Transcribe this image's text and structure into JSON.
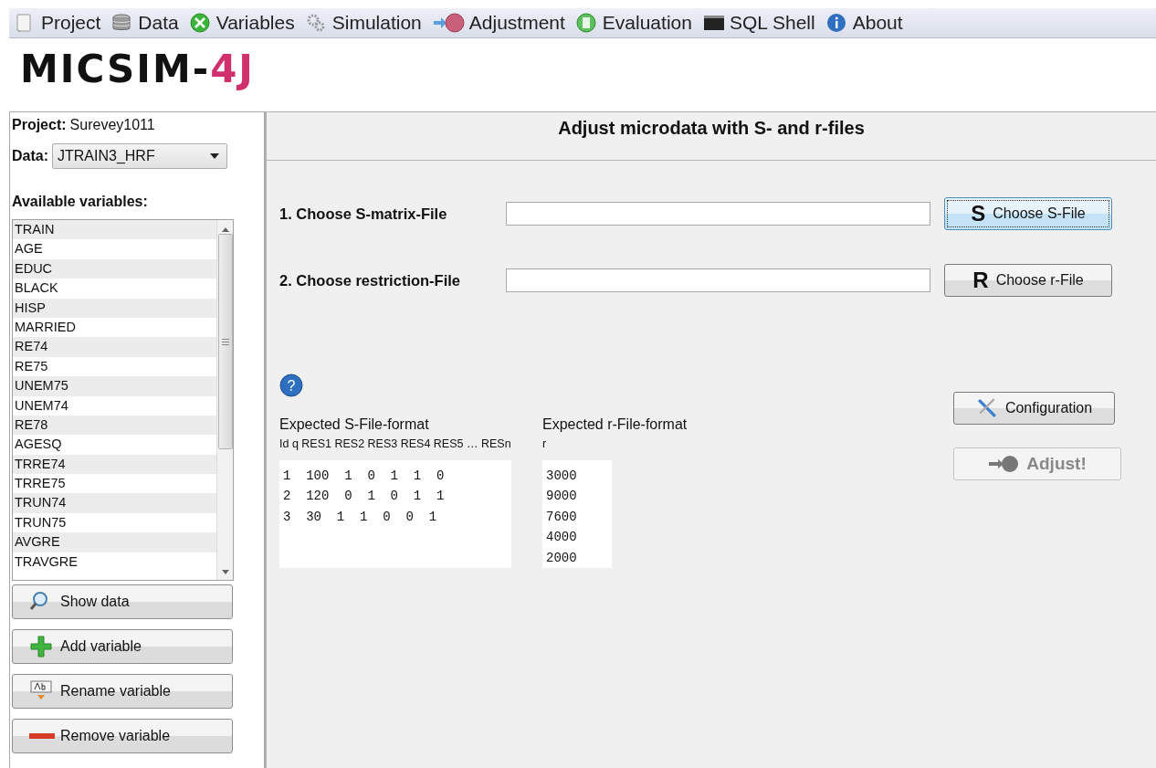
{
  "menu": [
    {
      "label": "Project"
    },
    {
      "label": "Data"
    },
    {
      "label": "Variables"
    },
    {
      "label": "Simulation"
    },
    {
      "label": "Adjustment"
    },
    {
      "label": "Evaluation"
    },
    {
      "label": "SQL Shell"
    },
    {
      "label": "About"
    }
  ],
  "logo": {
    "main": "MICSIM-",
    "accent": "4J"
  },
  "sidebar": {
    "project_label": "Project:",
    "project_name": "Surevey1011",
    "data_label": "Data:",
    "data_value": "JTRAIN3_HRF",
    "variables_heading": "Available variables:",
    "variables": [
      "TRAIN",
      "AGE",
      "EDUC",
      "BLACK",
      "HISP",
      "MARRIED",
      "RE74",
      "RE75",
      "UNEM75",
      "UNEM74",
      "RE78",
      "AGESQ",
      "TRRE74",
      "TRRE75",
      "TRUN74",
      "TRUN75",
      "AVGRE",
      "TRAVGRE"
    ],
    "buttons": [
      {
        "label": "Show data"
      },
      {
        "label": "Add variable"
      },
      {
        "label": "Rename variable"
      },
      {
        "label": "Remove variable"
      }
    ]
  },
  "main": {
    "title": "Adjust microdata with S- and r-files",
    "help_glyph": "?",
    "file_rows": [
      {
        "label": "1. Choose S-matrix-File",
        "value": "",
        "button": "Choose S-File",
        "button_letter": "S",
        "focused": true
      },
      {
        "label": "2. Choose restriction-File",
        "value": "",
        "button": "Choose r-File",
        "button_letter": "R",
        "focused": false
      }
    ],
    "s_format": {
      "heading": "Expected S-File-format",
      "columns": "Id q RES1 RES2 RES3 RES4 RES5 … RESn",
      "lines": [
        "1 100 1 0 1 1 0",
        "2 120 0 1 0 1 1",
        "3 30 1 1 0 0 1"
      ]
    },
    "r_format": {
      "heading": "Expected r-File-format",
      "columns": "r",
      "lines": [
        "3000",
        "9000",
        "7600",
        "4000",
        "2000"
      ]
    },
    "configuration_button": {
      "label": "Configuration",
      "disabled": false
    },
    "adjust_button": {
      "label": "Adjust!",
      "disabled": true
    }
  }
}
